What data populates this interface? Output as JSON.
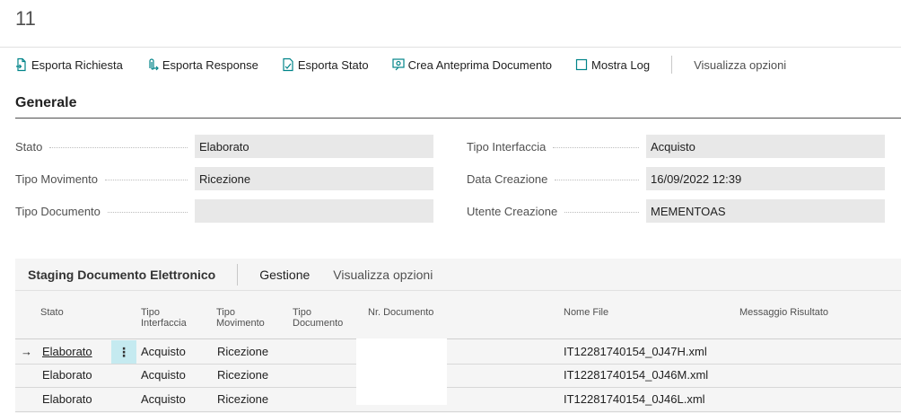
{
  "page": {
    "title": "11"
  },
  "actions": [
    {
      "label": "Esporta Richiesta",
      "icon": "document-export-icon"
    },
    {
      "label": "Esporta Response",
      "icon": "attachment-export-icon"
    },
    {
      "label": "Esporta Stato",
      "icon": "document-status-icon"
    },
    {
      "label": "Crea Anteprima Documento",
      "icon": "preview-document-icon"
    },
    {
      "label": "Mostra Log",
      "icon": "log-square-icon"
    },
    {
      "label": "Visualizza opzioni"
    }
  ],
  "general": {
    "title": "Generale",
    "left": [
      {
        "label": "Stato",
        "value": "Elaborato"
      },
      {
        "label": "Tipo Movimento",
        "value": "Ricezione"
      },
      {
        "label": "Tipo Documento",
        "value": ""
      }
    ],
    "right": [
      {
        "label": "Tipo Interfaccia",
        "value": "Acquisto"
      },
      {
        "label": "Data Creazione",
        "value": "16/09/2022 12:39"
      },
      {
        "label": "Utente Creazione",
        "value": "MEMENTOAS"
      }
    ]
  },
  "staging": {
    "title": "Staging Documento Elettronico",
    "links": [
      "Gestione",
      "Visualizza opzioni"
    ],
    "columns": [
      {
        "l1": "",
        "l2": "Stato"
      },
      {
        "l1": "Tipo",
        "l2": "Interfaccia"
      },
      {
        "l1": "Tipo",
        "l2": "Movimento"
      },
      {
        "l1": "Tipo",
        "l2": "Documento"
      },
      {
        "l1": "",
        "l2": "Nr. Documento"
      },
      {
        "l1": "",
        "l2": "Nome File"
      },
      {
        "l1": "",
        "l2": "Messaggio Risultato"
      }
    ],
    "rows": [
      {
        "stato": "Elaborato",
        "interfaccia": "Acquisto",
        "movimento": "Ricezione",
        "documento": "",
        "nr": "",
        "file": "IT12281740154_0J47H.xml",
        "messaggio": "",
        "selected": true
      },
      {
        "stato": "Elaborato",
        "interfaccia": "Acquisto",
        "movimento": "Ricezione",
        "documento": "",
        "nr": "",
        "file": "IT12281740154_0J46M.xml",
        "messaggio": ""
      },
      {
        "stato": "Elaborato",
        "interfaccia": "Acquisto",
        "movimento": "Ricezione",
        "documento": "",
        "nr": "",
        "file": "IT12281740154_0J46L.xml",
        "messaggio": ""
      }
    ],
    "row_indicator": "→",
    "row_menu": "⋮"
  },
  "colors": {
    "accent": "#008489",
    "field_bg": "#e8e8e8",
    "part_bg": "#f5f5f5",
    "selected_cell": "#c5eaf0"
  }
}
